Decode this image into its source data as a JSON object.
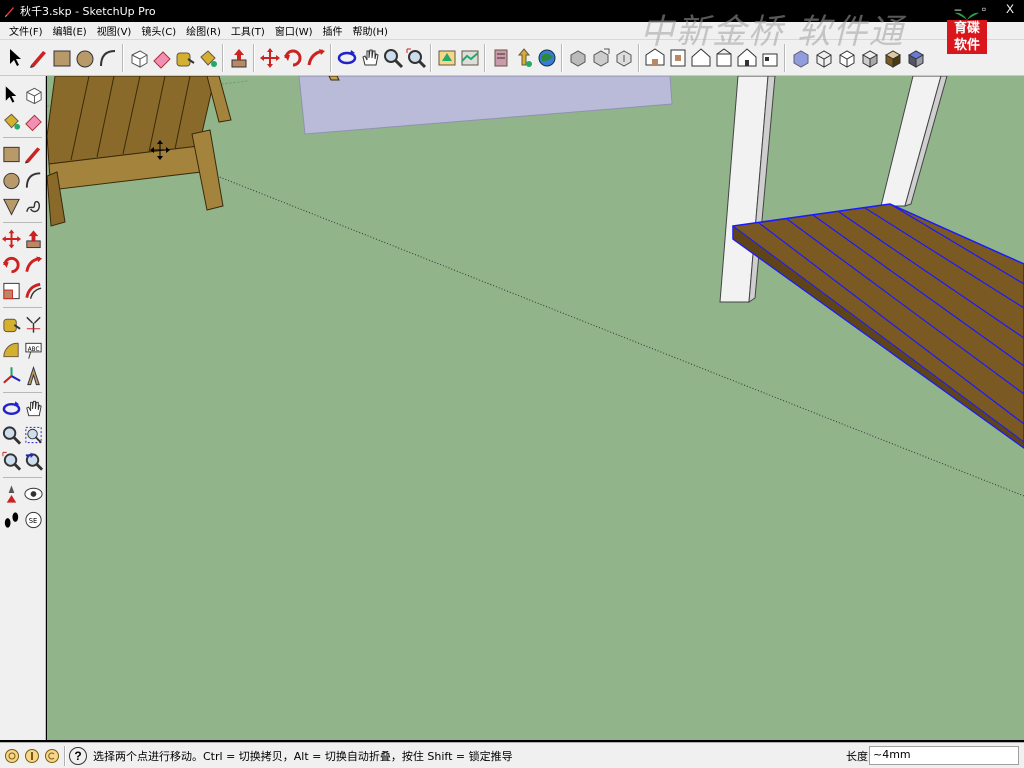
{
  "window": {
    "title": "秋千3.skp - SketchUp Pro",
    "minimize": "–",
    "maximize": "▫",
    "close": "X"
  },
  "watermark": "中新金桥  软件通",
  "brand": {
    "line1": "育碟",
    "line2": "软件",
    "color": "#d8161c"
  },
  "menu": {
    "items": [
      "文件(F)",
      "编辑(E)",
      "视图(V)",
      "镜头(C)",
      "绘图(R)",
      "工具(T)",
      "窗口(W)",
      "插件",
      "帮助(H)"
    ]
  },
  "toolbar": {
    "groups": [
      [
        "select-tool-icon",
        "pencil-tool-icon",
        "rectangle-tool-icon",
        "circle-tool-icon",
        "arc-tool-icon"
      ],
      [
        "make-component-icon",
        "eraser-tool-icon",
        "tape-measure-icon",
        "paint-bucket-icon"
      ],
      [
        "push-pull-icon"
      ],
      [
        "move-tool-icon",
        "rotate-tool-icon",
        "follow-me-icon"
      ],
      [
        "orbit-tool-icon",
        "pan-tool-icon",
        "zoom-tool-icon",
        "zoom-extents-icon"
      ],
      [
        "add-location-icon",
        "toggle-terrain-icon"
      ],
      [
        "get-models-icon",
        "share-model-icon",
        "preview-google-earth-icon"
      ],
      [
        "get-components-icon",
        "share-component-icon",
        "extension-warehouse-icon"
      ],
      [
        "iso-view-icon",
        "top-view-icon",
        "front-view-icon",
        "right-view-icon",
        "back-view-icon",
        "left-view-icon"
      ],
      [
        "xray-style-icon",
        "wireframe-style-icon",
        "hidden-line-style-icon",
        "shaded-style-icon",
        "shaded-textures-style-icon",
        "monochrome-style-icon"
      ]
    ]
  },
  "left_toolbar": {
    "rows": [
      [
        "select-tool-icon",
        "make-component-icon"
      ],
      [
        "paint-bucket-icon",
        "eraser-tool-icon"
      ],
      "sep",
      [
        "rectangle-tool-icon",
        "line-tool-icon"
      ],
      [
        "circle-tool-icon",
        "arc-tool-icon"
      ],
      [
        "polygon-tool-icon",
        "freehand-tool-icon"
      ],
      "sep",
      [
        "move-tool-icon",
        "push-pull-icon"
      ],
      [
        "rotate-tool-icon",
        "follow-me-icon"
      ],
      [
        "scale-tool-icon",
        "offset-tool-icon"
      ],
      "sep",
      [
        "tape-measure-icon",
        "dimension-tool-icon"
      ],
      [
        "protractor-tool-icon",
        "text-tool-icon"
      ],
      [
        "axes-tool-icon",
        "3d-text-tool-icon"
      ],
      "sep",
      [
        "orbit-tool-icon",
        "pan-tool-icon"
      ],
      [
        "zoom-tool-icon",
        "zoom-window-icon"
      ],
      [
        "zoom-extents-icon",
        "previous-view-icon"
      ],
      "sep",
      [
        "position-camera-icon",
        "look-around-icon"
      ],
      [
        "walk-tool-icon",
        "section-plane-icon"
      ]
    ]
  },
  "status": {
    "message": "选择两个点进行移动。Ctrl = 切换拷贝，Alt = 切换自动折叠，按住 Shift = 锁定推导",
    "measurement_label": "长度",
    "measurement_value": "~4mm"
  },
  "colors": {
    "sky_ground": "#91b48b",
    "wood": "#8a6a2a",
    "wood_light": "#a4843c",
    "selection_blue": "#1a1aff",
    "plane": "#b9bbd8"
  }
}
